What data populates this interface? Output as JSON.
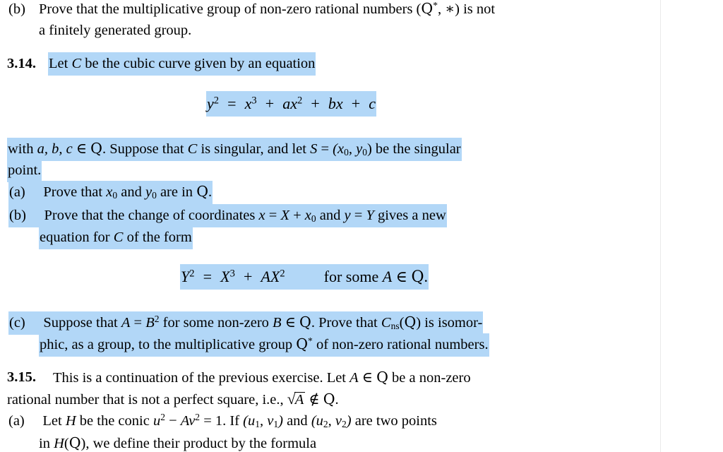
{
  "document": {
    "type": "textbook-exercise-page",
    "highlight_color": "#b2d7f7",
    "text_color": "#000000",
    "background_color": "#ffffff"
  },
  "exercise_prev": {
    "label": "(b)",
    "line1_a": "Prove that the multiplicative group of non-zero rational numbers (",
    "line1_q": "Q",
    "line1_star": "*",
    "line1_b": ", ",
    "line1_ast": "∗",
    "line1_c": ") is not",
    "line2": "a finitely generated group."
  },
  "exercise_314": {
    "number": "3.14.",
    "intro": "Let ",
    "intro_c": "C",
    "intro_rest": " be the cubic curve given by an equation",
    "equation": {
      "lhs_var": "y",
      "lhs_exp": "2",
      "eq": "=",
      "t1_var": "x",
      "t1_exp": "3",
      "plus1": "+",
      "t2_coef": "a",
      "t2_var": "x",
      "t2_exp": "2",
      "plus2": "+",
      "t3_coef": "b",
      "t3_var": "x",
      "plus3": "+",
      "t4_coef": "c",
      "plain": "y^2 = x^3 + ax^2 + bx + c"
    },
    "with_line1": {
      "p1": "with ",
      "p2": "a, b, c",
      "p3": " ∈ ",
      "p4": "Q",
      "p5": ". Suppose that ",
      "p6": "C",
      "p7": " is singular, and let ",
      "p8": "S",
      "p9": " = ",
      "p10": "(x",
      "p10sub": "0",
      "p11": ", y",
      "p11sub": "0",
      "p12": ") be the singular"
    },
    "with_line2": "point.",
    "items": [
      {
        "label": "(a)",
        "line1": {
          "t1": "Prove that ",
          "v1": "x",
          "v1sub": "0",
          "t2": " and ",
          "v2": "y",
          "v2sub": "0",
          "t3": " are in ",
          "q": "Q",
          "t4": "."
        }
      },
      {
        "label": "(b)",
        "line1": {
          "t1": "Prove that the change of coordinates ",
          "v1": "x",
          "eq1": " = ",
          "v2": "X",
          "plus": " + ",
          "v3": "x",
          "v3sub": "0",
          "t2": " and ",
          "v4": "y",
          "eq2": " = ",
          "v5": "Y",
          "t3": " gives a new"
        },
        "line2": {
          "t1": "equation for ",
          "v1": "C",
          "t2": " of the form"
        }
      },
      {
        "label": "(c)",
        "line1": {
          "t1": "Suppose that ",
          "v1": "A",
          "eq": " = ",
          "v2": "B",
          "v2exp": "2",
          "t2": " for some non-zero ",
          "v3": "B",
          "t3": " ∈ ",
          "q1": "Q",
          "t4": ". Prove that ",
          "v4": "C",
          "v4sub": "ns",
          "t5": "(",
          "q2": "Q",
          "t6": ") is isomor-"
        },
        "line2": {
          "t1": "phic, as a group, to the multiplicative group ",
          "q": "Q",
          "star": "*",
          "t2": " of non-zero rational numbers."
        }
      }
    ],
    "equation2": {
      "lhs_var": "Y",
      "lhs_exp": "2",
      "eq": "=",
      "t1_var": "X",
      "t1_exp": "3",
      "plus": "+",
      "t2_coef": "A",
      "t2_var": "X",
      "t2_exp": "2",
      "tail_t1": "for some ",
      "tail_v": "A",
      "tail_t2": " ∈ ",
      "tail_q": "Q",
      "tail_t3": ".",
      "plain": "Y^2 = X^3 + AX^2   for some A ∈ Q."
    }
  },
  "exercise_315": {
    "number": "3.15.",
    "line1": {
      "t1": "This is a continuation of the previous exercise. Let ",
      "v1": "A",
      "t2": " ∈ ",
      "q": "Q",
      "t3": " be a non-zero"
    },
    "line2": {
      "t1": "rational number that is not a perfect square, i.e., ",
      "sqrt_var": "A",
      "t2": " ∉ ",
      "q": "Q",
      "t3": "."
    },
    "items": [
      {
        "label": "(a)",
        "line1": {
          "t1": "Let ",
          "v1": "H",
          "t2": " be the conic ",
          "v2": "u",
          "v2exp": "2",
          "minus": " − ",
          "v3": "A",
          "v4": "v",
          "v4exp": "2",
          "eq": " = ",
          "one": "1",
          "t3": ". If ",
          "p1a": "(u",
          "p1asub": "1",
          "p1b": ", v",
          "p1bsub": "1",
          "p1c": ")",
          "t4": " and ",
          "p2a": "(u",
          "p2asub": "2",
          "p2b": ", v",
          "p2bsub": "2",
          "p2c": ")",
          "t5": " are two points"
        },
        "line2": {
          "t1": "in ",
          "v1": "H",
          "t2": "(",
          "q": "Q",
          "t3": "), we define their product by the formula"
        }
      }
    ]
  }
}
